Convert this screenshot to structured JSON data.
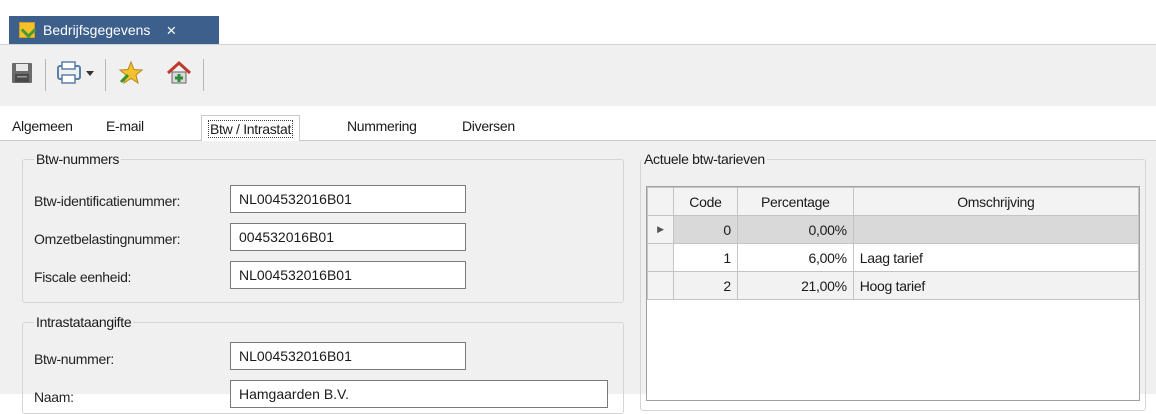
{
  "document_tab": {
    "title": "Bedrijfsgegevens",
    "close": "×"
  },
  "toolbar": {
    "buttons": [
      {
        "icon": "save-icon"
      },
      {
        "icon": "print-icon"
      },
      {
        "icon": "favorite-star-icon"
      },
      {
        "icon": "home-icon"
      }
    ]
  },
  "tabs": [
    {
      "label": "Algemeen"
    },
    {
      "label": "E-mail"
    },
    {
      "label": "Btw / Intrastat",
      "active": true
    },
    {
      "label": "Nummering"
    },
    {
      "label": "Diversen"
    }
  ],
  "btw_nummers": {
    "title": "Btw-nummers",
    "fields": [
      {
        "label": "Btw-identificatienummer:",
        "value": "NL004532016B01"
      },
      {
        "label": "Omzetbelastingnummer:",
        "value": "004532016B01"
      },
      {
        "label": "Fiscale eenheid:",
        "value": "NL004532016B01"
      }
    ]
  },
  "intrastat": {
    "title": "Intrastataangifte",
    "fields": [
      {
        "label": "Btw-nummer:",
        "value": "NL004532016B01"
      },
      {
        "label": "Naam:",
        "value": "Hamgaarden B.V."
      }
    ]
  },
  "tarieven": {
    "title": "Actuele btw-tarieven",
    "columns": [
      "Code",
      "Percentage",
      "Omschrijving"
    ],
    "rows": [
      {
        "code": "0",
        "percentage": "0,00%",
        "omschrijving": ""
      },
      {
        "code": "1",
        "percentage": "6,00%",
        "omschrijving": "Laag tarief"
      },
      {
        "code": "2",
        "percentage": "21,00%",
        "omschrijving": "Hoog tarief"
      }
    ],
    "current_row_marker": "▶"
  }
}
